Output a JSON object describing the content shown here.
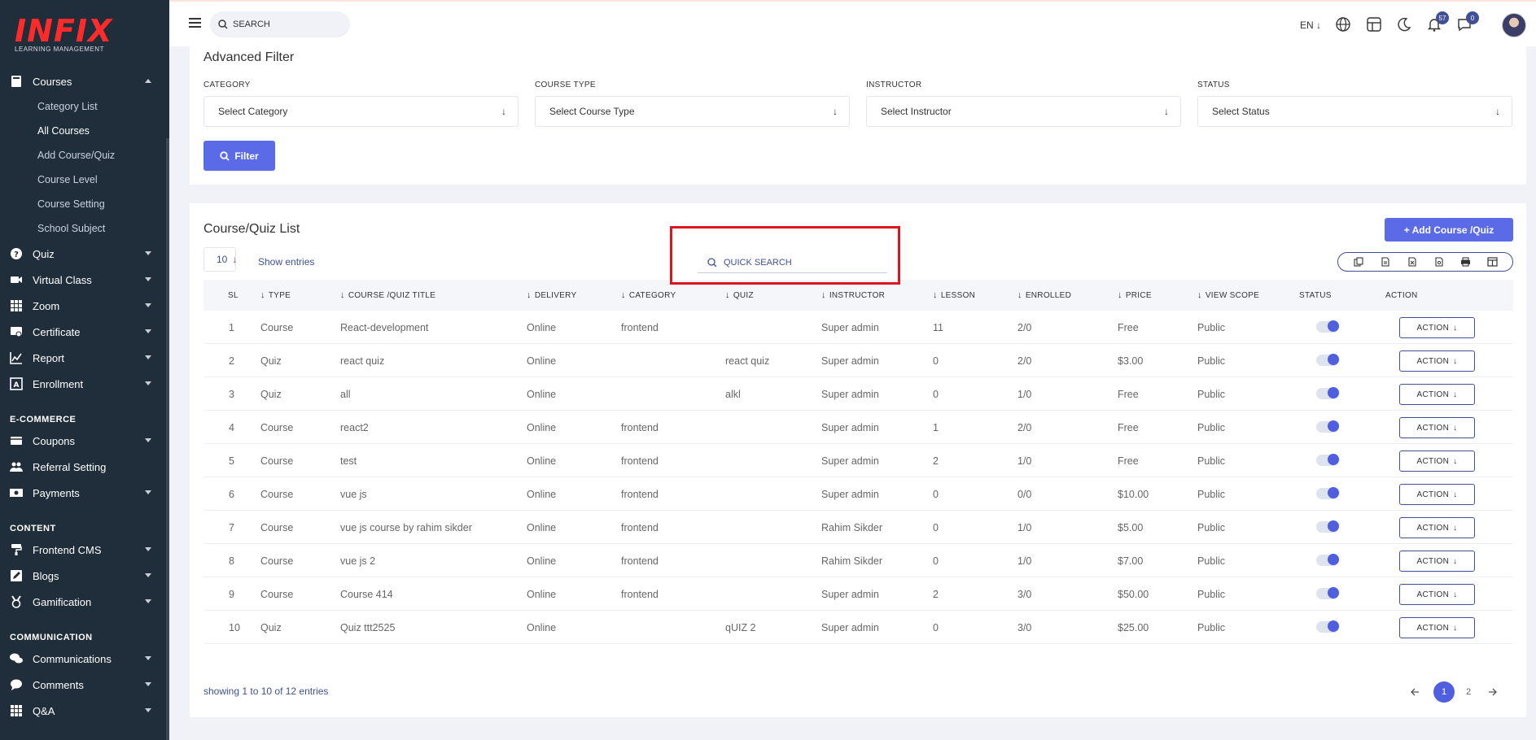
{
  "brand": {
    "logo_text": "INFIX",
    "logo_subtitle": "LEARNING MANAGEMENT",
    "color": "#ff2b2b"
  },
  "sidebar": {
    "courses": {
      "label": "Courses",
      "children": [
        "Category List",
        "All Courses",
        "Add Course/Quiz",
        "Course Level",
        "Course Setting",
        "School Subject"
      ]
    },
    "items_a": [
      {
        "label": "Quiz",
        "icon": "help-circle-icon"
      },
      {
        "label": "Virtual Class",
        "icon": "video-icon"
      },
      {
        "label": "Zoom",
        "icon": "grid-icon"
      },
      {
        "label": "Certificate",
        "icon": "certificate-icon"
      },
      {
        "label": "Report",
        "icon": "chart-icon"
      },
      {
        "label": "Enrollment",
        "icon": "enrollment-icon"
      }
    ],
    "section_ecommerce": "E-COMMERCE",
    "items_b": [
      {
        "label": "Coupons",
        "icon": "coupon-icon",
        "caret": true
      },
      {
        "label": "Referral Setting",
        "icon": "users-icon",
        "caret": false
      },
      {
        "label": "Payments",
        "icon": "money-icon",
        "caret": true
      }
    ],
    "section_content": "CONTENT",
    "items_c": [
      {
        "label": "Frontend CMS",
        "icon": "paint-roller-icon"
      },
      {
        "label": "Blogs",
        "icon": "edit-icon"
      },
      {
        "label": "Gamification",
        "icon": "medal-icon"
      }
    ],
    "section_communication": "COMMUNICATION",
    "items_d": [
      {
        "label": "Communications",
        "icon": "comments-icon"
      },
      {
        "label": "Comments",
        "icon": "comment-icon"
      },
      {
        "label": "Q&A",
        "icon": "qa-grid-icon"
      }
    ]
  },
  "topbar": {
    "search_placeholder": "SEARCH",
    "language": "EN",
    "notifications_count": "57",
    "messages_count": "0"
  },
  "filter": {
    "title": "Advanced Filter",
    "fields": [
      {
        "label": "CATEGORY",
        "placeholder": "Select Category"
      },
      {
        "label": "COURSE TYPE",
        "placeholder": "Select Course Type"
      },
      {
        "label": "INSTRUCTOR",
        "placeholder": "Select Instructor"
      },
      {
        "label": "STATUS",
        "placeholder": "Select Status"
      }
    ],
    "button_label": "Filter"
  },
  "list": {
    "title": "Course/Quiz List",
    "add_button_label": "+ Add Course /Quiz",
    "entries_value": "10",
    "entries_label": "Show entries",
    "quick_search_placeholder": "QUICK SEARCH",
    "columns": [
      "SL",
      "TYPE",
      "COURSE /QUIZ TITLE",
      "DELIVERY",
      "CATEGORY",
      "QUIZ",
      "INSTRUCTOR",
      "LESSON",
      "ENROLLED",
      "PRICE",
      "VIEW SCOPE",
      "STATUS",
      "ACTION"
    ],
    "action_label": "ACTION",
    "rows": [
      {
        "sl": "1",
        "type": "Course",
        "title": "React-development",
        "delivery": "Online",
        "category": "frontend",
        "quiz": "",
        "instructor": "Super admin",
        "lesson": "11",
        "enrolled": "2/0",
        "price": "Free",
        "scope": "Public",
        "status_on": true
      },
      {
        "sl": "2",
        "type": "Quiz",
        "title": "react quiz",
        "delivery": "Online",
        "category": "",
        "quiz": "react quiz",
        "instructor": "Super admin",
        "lesson": "0",
        "enrolled": "2/0",
        "price": "$3.00",
        "scope": "Public",
        "status_on": true
      },
      {
        "sl": "3",
        "type": "Quiz",
        "title": "all",
        "delivery": "Online",
        "category": "",
        "quiz": "alkl",
        "instructor": "Super admin",
        "lesson": "0",
        "enrolled": "1/0",
        "price": "Free",
        "scope": "Public",
        "status_on": true
      },
      {
        "sl": "4",
        "type": "Course",
        "title": "react2",
        "delivery": "Online",
        "category": "frontend",
        "quiz": "",
        "instructor": "Super admin",
        "lesson": "1",
        "enrolled": "2/0",
        "price": "Free",
        "scope": "Public",
        "status_on": true
      },
      {
        "sl": "5",
        "type": "Course",
        "title": "test",
        "delivery": "Online",
        "category": "frontend",
        "quiz": "",
        "instructor": "Super admin",
        "lesson": "2",
        "enrolled": "1/0",
        "price": "Free",
        "scope": "Public",
        "status_on": true
      },
      {
        "sl": "6",
        "type": "Course",
        "title": "vue js",
        "delivery": "Online",
        "category": "frontend",
        "quiz": "",
        "instructor": "Super admin",
        "lesson": "0",
        "enrolled": "0/0",
        "price": "$10.00",
        "scope": "Public",
        "status_on": true
      },
      {
        "sl": "7",
        "type": "Course",
        "title": "vue js course by rahim sikder",
        "delivery": "Online",
        "category": "frontend",
        "quiz": "",
        "instructor": "Rahim Sikder",
        "lesson": "0",
        "enrolled": "1/0",
        "price": "$5.00",
        "scope": "Public",
        "status_on": true
      },
      {
        "sl": "8",
        "type": "Course",
        "title": "vue js 2",
        "delivery": "Online",
        "category": "frontend",
        "quiz": "",
        "instructor": "Rahim Sikder",
        "lesson": "0",
        "enrolled": "1/0",
        "price": "$7.00",
        "scope": "Public",
        "status_on": true
      },
      {
        "sl": "9",
        "type": "Course",
        "title": "Course 414",
        "delivery": "Online",
        "category": "frontend",
        "quiz": "",
        "instructor": "Super admin",
        "lesson": "2",
        "enrolled": "3/0",
        "price": "$50.00",
        "scope": "Public",
        "status_on": true
      },
      {
        "sl": "10",
        "type": "Quiz",
        "title": "Quiz ttt2525",
        "delivery": "Online",
        "category": "",
        "quiz": "qUIZ 2",
        "instructor": "Super admin",
        "lesson": "0",
        "enrolled": "3/0",
        "price": "$25.00",
        "scope": "Public",
        "status_on": true
      }
    ],
    "showing_text": "showing 1 to 10 of 12 entries",
    "pages": [
      "1",
      "2"
    ],
    "current_page": "1"
  },
  "colors": {
    "primary": "#5b6be8",
    "sidebar_bg": "#202e3b",
    "text_accent": "#415094",
    "highlight": "#e0141e"
  }
}
